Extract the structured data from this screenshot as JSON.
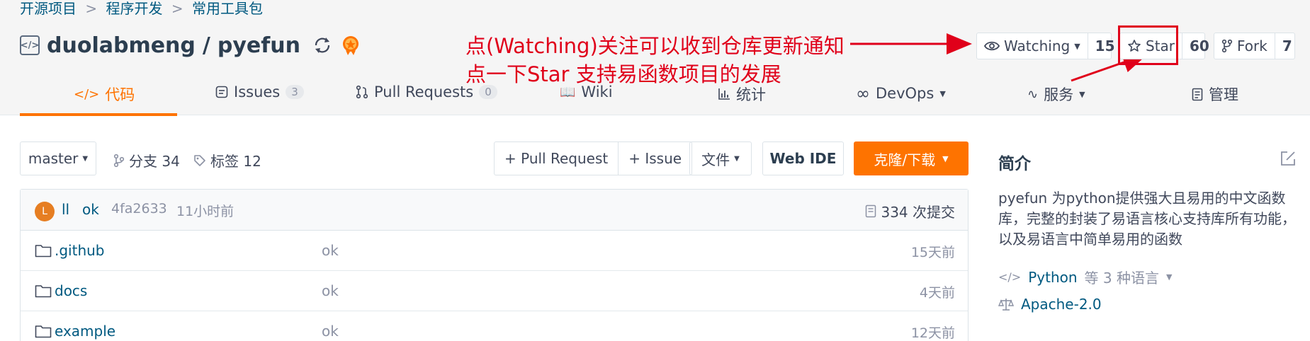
{
  "breadcrumb": {
    "item1": "开源项目",
    "item2": "程序开发",
    "item3": "常用工具包",
    "separator": ">"
  },
  "repo": {
    "owner": "duolabmeng",
    "slash": "/",
    "name": "pyefun",
    "icon_text": "</>"
  },
  "annotation": {
    "line1": "点(Watching)关注可以收到仓库更新通知",
    "line2": "点一下Star 支持易函数项目的发展",
    "color": "#e0001a"
  },
  "actions": {
    "watch_label": "Watching",
    "watch_count": "15",
    "star_label": "Star",
    "star_count": "60",
    "fork_label": "Fork",
    "fork_count": "7"
  },
  "tabs": {
    "code": "代码",
    "issues": "Issues",
    "issues_count": "3",
    "pulls": "Pull Requests",
    "pulls_count": "0",
    "wiki": "Wiki",
    "stats": "统计",
    "devops": "DevOps",
    "services": "服务",
    "manage": "管理"
  },
  "toolbar": {
    "branch": "master",
    "branches": "分支 34",
    "tags": "标签 12",
    "pull_request": "+ Pull Request",
    "issue": "+ Issue",
    "file": "文件",
    "web_ide": "Web IDE",
    "clone": "克隆/下载"
  },
  "commit": {
    "avatar_letter": "L",
    "author": "ll",
    "message": "ok",
    "sha": "4fa2633",
    "time": "11小时前",
    "count": "334 次提交"
  },
  "files": [
    {
      "name": ".github",
      "message": "ok",
      "time": "15天前"
    },
    {
      "name": "docs",
      "message": "ok",
      "time": "4天前"
    },
    {
      "name": "example",
      "message": "ok",
      "time": "12天前"
    }
  ],
  "sidebar": {
    "title": "简介",
    "description": "pyefun 为python提供强大且易用的中文函数库，完整的封装了易语言核心支持库所有功能，以及易语言中简单易用的函数",
    "language": "Python",
    "language_more": "等 3 种语言",
    "license": "Apache-2.0"
  },
  "colors": {
    "accent": "#fe7300",
    "link": "#005980",
    "annotation": "#e0001a"
  }
}
